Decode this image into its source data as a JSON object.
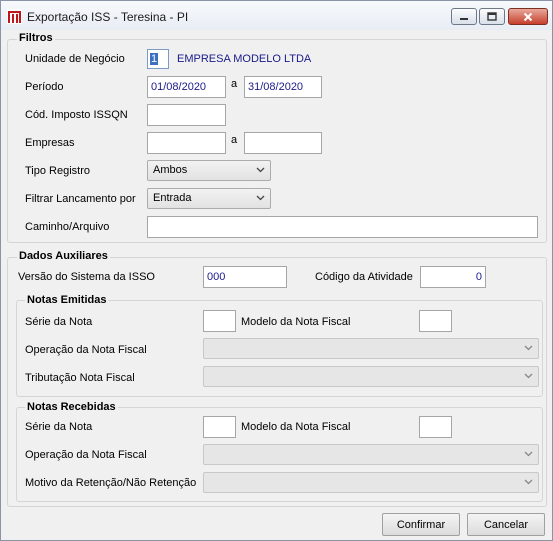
{
  "window": {
    "title": "Exportação ISS - Teresina - PI"
  },
  "filtros": {
    "title": "Filtros",
    "unidade_label": "Unidade de Negócio",
    "unidade_code": "1",
    "unidade_name": "EMPRESA MODELO LTDA",
    "periodo_label": "Período",
    "periodo_inicio": "01/08/2020",
    "periodo_sep": "a",
    "periodo_fim": "31/08/2020",
    "cod_imposto_label": "Cód. Imposto ISSQN",
    "cod_imposto_value": "",
    "empresas_label": "Empresas",
    "empresas_inicio": "",
    "empresas_sep": "a",
    "empresas_fim": "",
    "tipo_registro_label": "Tipo Registro",
    "tipo_registro_value": "Ambos",
    "filtrar_label": "Filtrar Lancamento por",
    "filtrar_value": "Entrada",
    "caminho_label": "Caminho/Arquivo",
    "caminho_value": ""
  },
  "auxiliares": {
    "title": "Dados Auxiliares",
    "versao_label": "Versão do Sistema da ISSO",
    "versao_value": "000",
    "codigo_atividade_label": "Código da Atividade",
    "codigo_atividade_value": "0"
  },
  "notas_emitidas": {
    "title": "Notas Emitidas",
    "serie_label": "Série da Nota",
    "serie_value": "",
    "modelo_label": "Modelo da Nota Fiscal",
    "modelo_value": "",
    "operacao_label": "Operação da Nota Fiscal",
    "operacao_value": "",
    "tributacao_label": "Tributação Nota Fiscal",
    "tributacao_value": ""
  },
  "notas_recebidas": {
    "title": "Notas Recebidas",
    "serie_label": "Série da Nota",
    "serie_value": "",
    "modelo_label": "Modelo da Nota Fiscal",
    "modelo_value": "",
    "operacao_label": "Operação da Nota Fiscal",
    "operacao_value": "",
    "motivo_label": "Motivo da Retenção/Não Retenção",
    "motivo_value": ""
  },
  "buttons": {
    "confirmar": "Confirmar",
    "cancelar": "Cancelar"
  },
  "colors": {
    "accent_value_text": "#1a1a8c",
    "close_button": "#c7402c",
    "app_icon": "#c0161a"
  }
}
